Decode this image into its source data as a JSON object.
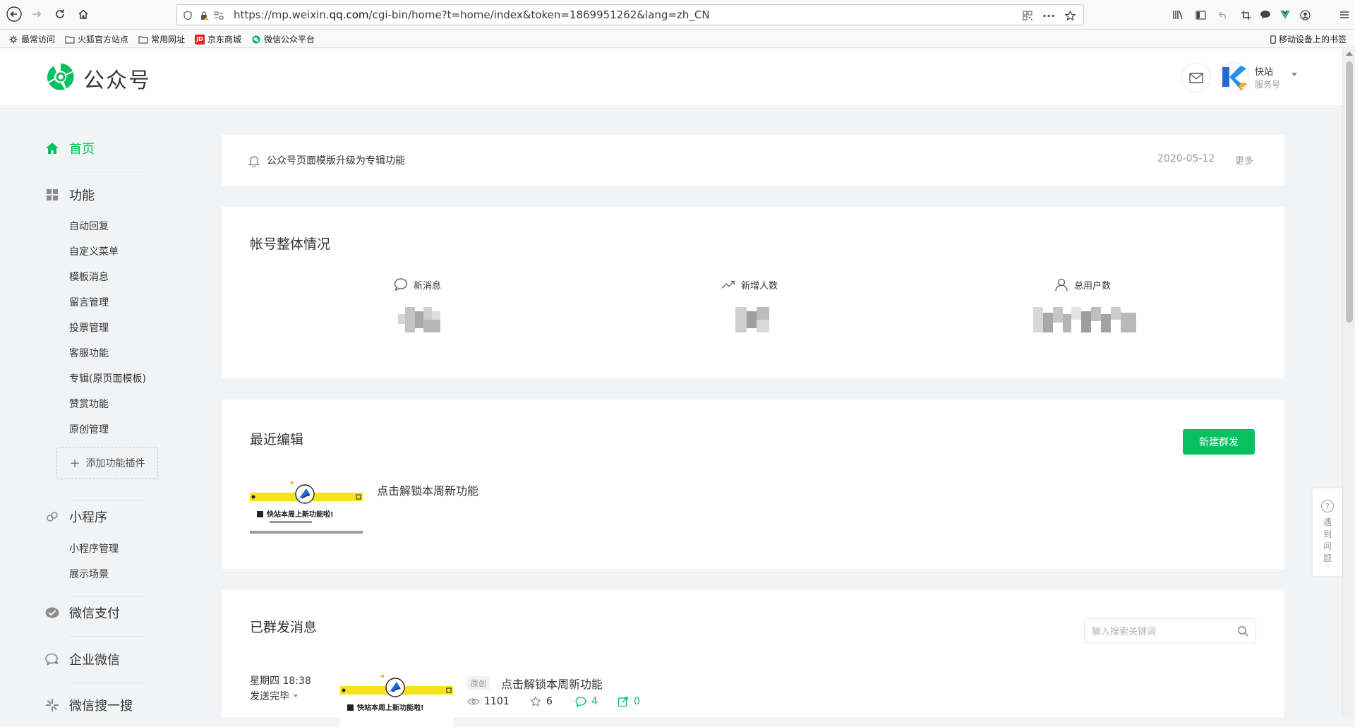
{
  "browser": {
    "url_prefix": "https://mp.weixin.",
    "url_domain": "qq.com",
    "url_suffix": "/cgi-bin/home?t=home/index&token=1869951262&lang=zh_CN",
    "bookmarks": [
      "最常访问",
      "火狐官方站点",
      "常用网址",
      "京东商城",
      "微信公众平台"
    ],
    "mobile_bookmarks": "移动设备上的书签"
  },
  "header": {
    "logo_text": "公众号",
    "account_name": "快站",
    "account_type": "服务号"
  },
  "sidebar": {
    "home": "首页",
    "functions": "功能",
    "function_items": [
      "自动回复",
      "自定义菜单",
      "模板消息",
      "留言管理",
      "投票管理",
      "客服功能",
      "专辑(原页面模板)",
      "赞赏功能",
      "原创管理"
    ],
    "add_plugin": "添加功能插件",
    "mini_program": "小程序",
    "mini_items": [
      "小程序管理",
      "展示场景"
    ],
    "wechat_pay": "微信支付",
    "wecom": "企业微信",
    "wechat_search": "微信搜一搜"
  },
  "notice": {
    "text": "公众号页面模版升级为专辑功能",
    "date": "2020-05-12",
    "more": "更多"
  },
  "overview": {
    "title": "帐号整体情况",
    "stats": [
      {
        "label": "新消息",
        "icon": "chat-bubble-icon"
      },
      {
        "label": "新增人数",
        "icon": "trend-up-icon"
      },
      {
        "label": "总用户数",
        "icon": "user-icon"
      }
    ]
  },
  "recent": {
    "title": "最近编辑",
    "new_button": "新建群发",
    "article_title": "点击解锁本周新功能",
    "thumb_caption": "快站本周上新功能啦!"
  },
  "sent": {
    "title": "已群发消息",
    "search_placeholder": "输入搜索关键词",
    "time": "星期四 18:38",
    "status": "发送完毕",
    "badge": "原创",
    "article_title": "点击解锁本周新功能",
    "views": "1101",
    "likes": "6",
    "comments": "4",
    "shares": "0"
  },
  "help": {
    "label": "遇到问题"
  },
  "colors": {
    "accent": "#07c160",
    "text": "#353535",
    "muted": "#9a9a9a"
  }
}
